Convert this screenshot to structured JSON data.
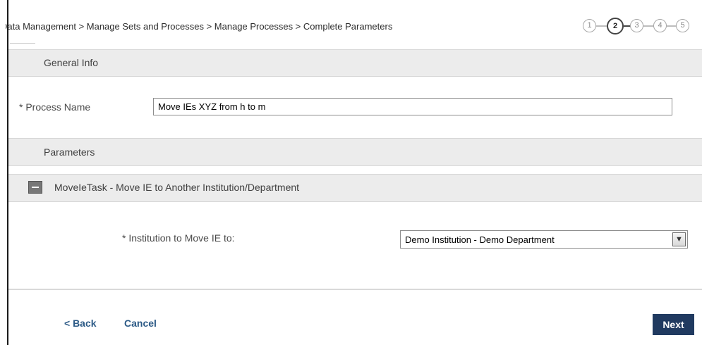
{
  "breadcrumb": {
    "text": "Data Management > Manage Sets and Processes > Manage Processes > Complete Parameters"
  },
  "wizard": {
    "steps": [
      "1",
      "2",
      "3",
      "4",
      "5"
    ],
    "current_step": 2
  },
  "general_info": {
    "title": "General Info",
    "process_name_label": "* Process Name",
    "process_name_value": "Move IEs XYZ from h to m"
  },
  "parameters": {
    "title": "Parameters",
    "task_label": "MoveIeTask - Move IE to Another Institution/Department",
    "institution_label": "* Institution to Move IE to:",
    "institution_value": "Demo Institution - Demo Department"
  },
  "footer": {
    "back_label": "< Back",
    "cancel_label": "Cancel",
    "next_label": "Next"
  },
  "colors": {
    "next_button_bg": "#203a60",
    "link": "#2c5a86",
    "section_bg": "#ececec"
  },
  "icons": {
    "collapse": "minus-square-icon",
    "dropdown": "chevron-down-icon"
  }
}
